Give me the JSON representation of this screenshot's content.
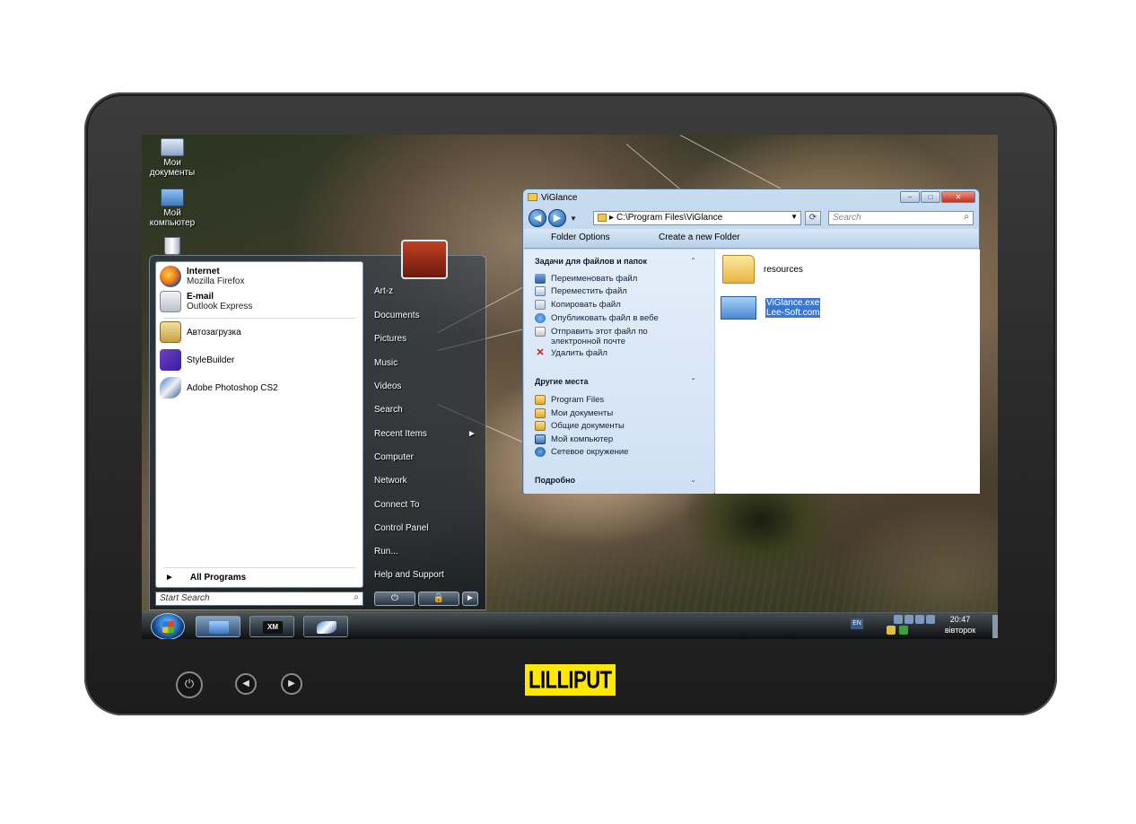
{
  "brand": "LILLIPUT",
  "hardware_buttons": {
    "power_icon": "power-icon",
    "left_icon": "arrow-left-icon",
    "right_icon": "arrow-right-icon"
  },
  "desktop_icons": [
    {
      "label": "Мои документы",
      "icon": "documents-icon"
    },
    {
      "label": "Мой компьютер",
      "icon": "computer-icon"
    },
    {
      "label": "",
      "icon": "recycle-bin-icon"
    }
  ],
  "start_menu": {
    "pinned": [
      {
        "title": "Internet",
        "subtitle": "Mozilla Firefox",
        "icon": "firefox-icon"
      },
      {
        "title": "E-mail",
        "subtitle": "Outlook Express",
        "icon": "mail-icon"
      }
    ],
    "recent": [
      {
        "label": "Автозагрузка",
        "icon": "autostart-icon"
      },
      {
        "label": "StyleBuilder",
        "icon": "stylebuilder-icon"
      },
      {
        "label": "Adobe Photoshop CS2",
        "icon": "photoshop-icon"
      }
    ],
    "all_programs": "All Programs",
    "search_placeholder": "Start Search",
    "right_items": [
      "Art-z",
      "Documents",
      "Pictures",
      "Music",
      "Videos",
      "Search",
      "Recent Items",
      "Computer",
      "Network",
      "Connect To",
      "Control Panel",
      "Run...",
      "Help and Support"
    ],
    "recent_items_arrow": "►",
    "power_symbol": "⏻",
    "lock_symbol": "🔒",
    "arrow_symbol": "►"
  },
  "explorer": {
    "title": "ViGlance",
    "address": "C:\\Program Files\\ViGlance",
    "search_placeholder": "Search",
    "toolbar": [
      "Folder Options",
      "Create a new Folder"
    ],
    "tasks_header": "Задачи для файлов и папок",
    "tasks": [
      {
        "label": "Переименовать файл",
        "icon": "rename-icon"
      },
      {
        "label": "Переместить файл",
        "icon": "move-icon"
      },
      {
        "label": "Копировать файл",
        "icon": "copy-icon"
      },
      {
        "label": "Опубликовать файл в вебе",
        "icon": "web-publish-icon"
      },
      {
        "label": "Отправить этот файл по электронной почте",
        "icon": "email-icon"
      },
      {
        "label": "Удалить файл",
        "icon": "delete-icon"
      }
    ],
    "places_header": "Другие места",
    "places": [
      {
        "label": "Program Files",
        "icon": "folder-icon"
      },
      {
        "label": "Мои документы",
        "icon": "folder-icon"
      },
      {
        "label": "Общие документы",
        "icon": "folder-icon"
      },
      {
        "label": "Мой компьютер",
        "icon": "computer-icon"
      },
      {
        "label": "Сетевое окружение",
        "icon": "network-icon"
      }
    ],
    "details_header": "Подробно",
    "files": [
      {
        "name": "resources",
        "icon": "folder-icon"
      },
      {
        "name": "ViGlance.exe",
        "detail": "Lee-Soft.com",
        "icon": "exe-icon",
        "selected": true
      }
    ]
  },
  "taskbar": {
    "apps": [
      {
        "name": "explorer",
        "icon": "explorer-icon",
        "active": true
      },
      {
        "name": "XMplay",
        "label": "XM",
        "icon": "xmplay-icon"
      },
      {
        "name": "photoshop",
        "icon": "photoshop-icon"
      }
    ],
    "lang": "EN",
    "time": "20:47",
    "day": "вівторок"
  }
}
